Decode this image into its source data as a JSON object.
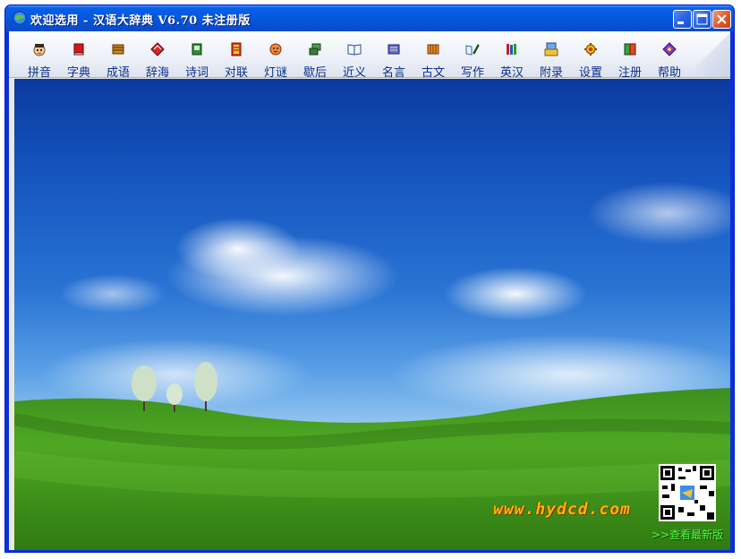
{
  "window": {
    "title": "欢迎选用 - 汉语大辞典 V6.70 未注册版",
    "controls": {
      "minimize": "minimize-icon",
      "maximize": "maximize-icon",
      "close": "close-icon"
    }
  },
  "toolbar": {
    "items": [
      {
        "label": "拼音",
        "icon": "face-icon"
      },
      {
        "label": "字典",
        "icon": "red-book-icon"
      },
      {
        "label": "成语",
        "icon": "brown-book-icon"
      },
      {
        "label": "辞海",
        "icon": "diamond-book-icon"
      },
      {
        "label": "诗词",
        "icon": "green-book-icon"
      },
      {
        "label": "对联",
        "icon": "couplet-icon"
      },
      {
        "label": "灯谜",
        "icon": "lantern-icon"
      },
      {
        "label": "歇后",
        "icon": "cards-icon"
      },
      {
        "label": "近义",
        "icon": "open-book-icon"
      },
      {
        "label": "名言",
        "icon": "notebook-icon"
      },
      {
        "label": "古文",
        "icon": "scroll-icon"
      },
      {
        "label": "写作",
        "icon": "pen-book-icon"
      },
      {
        "label": "英汉",
        "icon": "books-icon"
      },
      {
        "label": "附录",
        "icon": "appendix-icon"
      },
      {
        "label": "设置",
        "icon": "gear-icon"
      },
      {
        "label": "注册",
        "icon": "register-icon"
      },
      {
        "label": "帮助",
        "icon": "help-book-icon"
      }
    ]
  },
  "content": {
    "website": "www.hydcd.com",
    "update_link": ">>查看最新版"
  }
}
